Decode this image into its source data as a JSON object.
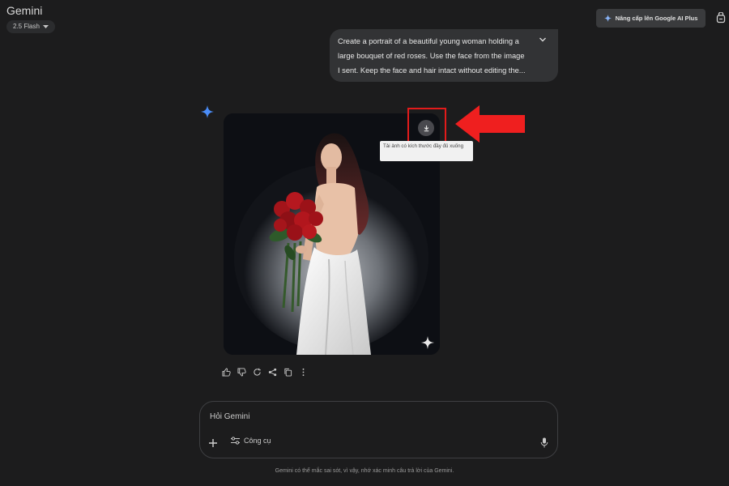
{
  "header": {
    "app_title": "Gemini",
    "model_label": "2.5 Flash",
    "upgrade_label": "Nâng cấp lên Google AI Plus"
  },
  "prompt": {
    "text": "Create a portrait of a beautiful young woman holding a\nlarge bouquet of red roses. Use the face from the image\nI sent. Keep the face and hair intact without editing the..."
  },
  "response": {
    "tooltip": "Tải ảnh có kích thước đầy đủ xuống"
  },
  "input": {
    "placeholder": "Hỏi Gemini",
    "tools_label": "Công cụ"
  },
  "footer": {
    "disclaimer": "Gemini có thể mắc sai sót, vì vậy, nhớ xác minh câu trả lời của Gemini."
  },
  "colors": {
    "background": "#1c1c1d",
    "accent_blue": "#4a8cf7",
    "annotation_red": "#e21b1b"
  }
}
